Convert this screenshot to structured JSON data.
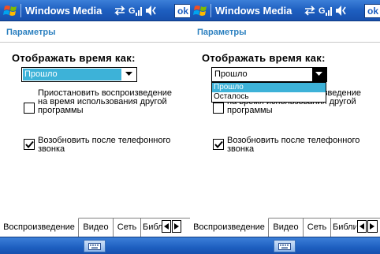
{
  "colors": {
    "titlebar": "#1e5fc0",
    "header_text": "#2a7fbf",
    "selection": "#3db2d8",
    "tab_border": "#808080"
  },
  "panes": [
    {
      "titlebar": {
        "title": "Windows Media",
        "ok_label": "ok"
      },
      "header": "Параметры",
      "display_time_label": "Отображать время как:",
      "dropdown": {
        "value": "Прошло",
        "expanded": false,
        "options": []
      },
      "checkboxes": [
        {
          "label": "Приостановить воспроизведение на время использования другой программы",
          "checked": false
        },
        {
          "label": "Возобновить после телефонного звонка",
          "checked": true
        }
      ],
      "tabs": [
        "Воспроизведение",
        "Видео",
        "Сеть",
        "Библ"
      ],
      "active_tab": 0
    },
    {
      "titlebar": {
        "title": "Windows Media",
        "ok_label": "ok"
      },
      "header": "Параметры",
      "display_time_label": "Отображать время как:",
      "dropdown": {
        "value": "Прошло",
        "expanded": true,
        "options": [
          "Прошло",
          "Осталось"
        ],
        "highlighted": 0
      },
      "checkboxes": [
        {
          "label": "Приостановить воспроизведение на время использования другой программы",
          "checked": false
        },
        {
          "label": "Возобновить после телефонного звонка",
          "checked": true
        }
      ],
      "tabs": [
        "Воспроизведение",
        "Видео",
        "Сеть",
        "Библи"
      ],
      "active_tab": 0
    }
  ],
  "icons": {
    "start": "windows-logo-icon",
    "sync": "sync-arrows-icon",
    "signal": "signal-strength-icon",
    "volume": "volume-icon",
    "keyboard": "keyboard-icon"
  }
}
